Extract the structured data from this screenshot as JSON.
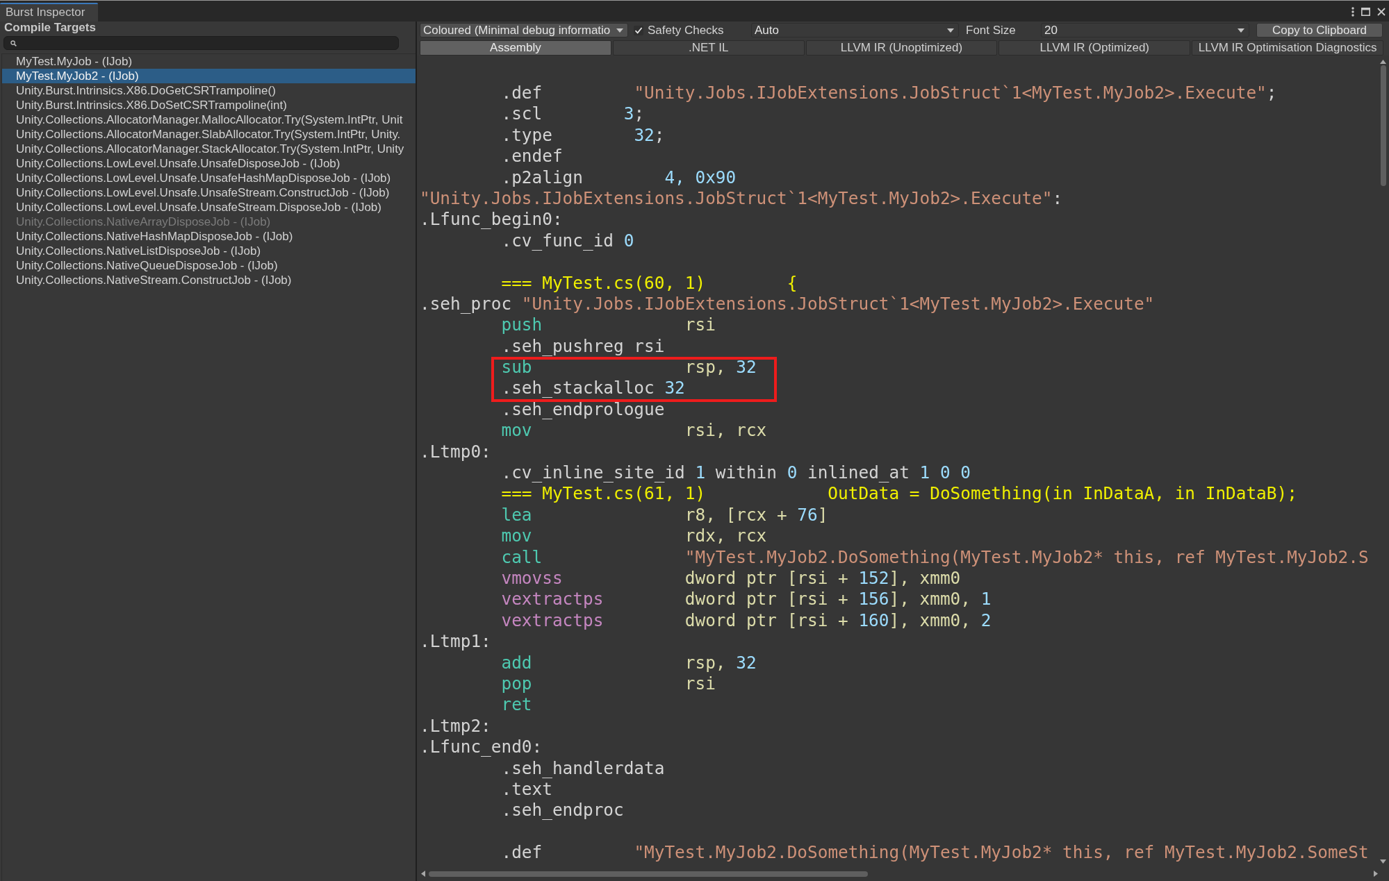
{
  "window": {
    "tab": "Burst Inspector"
  },
  "sidebar": {
    "title": "Compile Targets",
    "items": [
      {
        "label": "MyTest.MyJob - (IJob)",
        "selected": false,
        "disabled": false
      },
      {
        "label": "MyTest.MyJob2 - (IJob)",
        "selected": true,
        "disabled": false
      },
      {
        "label": "Unity.Burst.Intrinsics.X86.DoGetCSRTrampoline()",
        "selected": false,
        "disabled": false
      },
      {
        "label": "Unity.Burst.Intrinsics.X86.DoSetCSRTrampoline(int)",
        "selected": false,
        "disabled": false
      },
      {
        "label": "Unity.Collections.AllocatorManager.MallocAllocator.Try(System.IntPtr, Unit",
        "selected": false,
        "disabled": false
      },
      {
        "label": "Unity.Collections.AllocatorManager.SlabAllocator.Try(System.IntPtr, Unity.",
        "selected": false,
        "disabled": false
      },
      {
        "label": "Unity.Collections.AllocatorManager.StackAllocator.Try(System.IntPtr, Unity",
        "selected": false,
        "disabled": false
      },
      {
        "label": "Unity.Collections.LowLevel.Unsafe.UnsafeDisposeJob - (IJob)",
        "selected": false,
        "disabled": false
      },
      {
        "label": "Unity.Collections.LowLevel.Unsafe.UnsafeHashMapDisposeJob - (IJob)",
        "selected": false,
        "disabled": false
      },
      {
        "label": "Unity.Collections.LowLevel.Unsafe.UnsafeStream.ConstructJob - (IJob)",
        "selected": false,
        "disabled": false
      },
      {
        "label": "Unity.Collections.LowLevel.Unsafe.UnsafeStream.DisposeJob - (IJob)",
        "selected": false,
        "disabled": false
      },
      {
        "label": "Unity.Collections.NativeArrayDisposeJob - (IJob)",
        "selected": false,
        "disabled": true
      },
      {
        "label": "Unity.Collections.NativeHashMapDisposeJob - (IJob)",
        "selected": false,
        "disabled": false
      },
      {
        "label": "Unity.Collections.NativeListDisposeJob - (IJob)",
        "selected": false,
        "disabled": false
      },
      {
        "label": "Unity.Collections.NativeQueueDisposeJob - (IJob)",
        "selected": false,
        "disabled": false
      },
      {
        "label": "Unity.Collections.NativeStream.ConstructJob - (IJob)",
        "selected": false,
        "disabled": false
      }
    ]
  },
  "toolbar": {
    "output_mode": {
      "value": "Coloured (Minimal debug informatio"
    },
    "safety_checks": {
      "label": "Safety Checks",
      "checked": true
    },
    "target": {
      "value": "Auto"
    },
    "font_size": {
      "label": "Font Size",
      "value": "20"
    },
    "copy_button": "Copy to Clipboard"
  },
  "tabs": [
    {
      "label": "Assembly",
      "selected": true
    },
    {
      "label": ".NET IL",
      "selected": false
    },
    {
      "label": "LLVM IR (Unoptimized)",
      "selected": false
    },
    {
      "label": "LLVM IR (Optimized)",
      "selected": false
    },
    {
      "label": "LLVM IR Optimisation Diagnostics",
      "selected": false
    }
  ],
  "code": {
    "sections": [
      {
        "gap_before": false,
        "boxed": false,
        "lines": [
          {
            "indented": true,
            "parts": [
              {
                "text": ".def         ",
                "kind": "plain"
              },
              {
                "text": "\"Unity.Jobs.IJobExtensions.JobStruct`1<MyTest.MyJob2>.Execute\"",
                "kind": "str"
              },
              {
                "text": ";",
                "kind": "plain"
              }
            ]
          },
          {
            "indented": true,
            "parts": [
              {
                "text": ".scl        ",
                "kind": "plain"
              },
              {
                "text": "3",
                "kind": "num"
              },
              {
                "text": ";",
                "kind": "plain"
              }
            ]
          },
          {
            "indented": true,
            "parts": [
              {
                "text": ".type        ",
                "kind": "plain"
              },
              {
                "text": "32",
                "kind": "num"
              },
              {
                "text": ";",
                "kind": "plain"
              }
            ]
          },
          {
            "indented": true,
            "parts": [
              {
                "text": ".endef",
                "kind": "plain"
              }
            ]
          },
          {
            "indented": true,
            "parts": [
              {
                "text": ".p2align        ",
                "kind": "plain"
              },
              {
                "text": "4, 0x90",
                "kind": "num"
              }
            ]
          },
          {
            "indented": false,
            "parts": [
              {
                "text": "\"Unity.Jobs.IJobExtensions.JobStruct`1<MyTest.MyJob2>.Execute\"",
                "kind": "str"
              },
              {
                "text": ":",
                "kind": "plain"
              }
            ]
          },
          {
            "indented": false,
            "parts": [
              {
                "text": ".Lfunc_begin0:",
                "kind": "plain"
              }
            ]
          },
          {
            "indented": true,
            "parts": [
              {
                "text": ".cv_func_id ",
                "kind": "plain"
              },
              {
                "text": "0",
                "kind": "num"
              }
            ]
          }
        ]
      },
      {
        "gap_before": true,
        "boxed": false,
        "lines": [
          {
            "indented": true,
            "parts": [
              {
                "text": "=== MyTest.cs(60, 1)        {",
                "kind": "src"
              }
            ]
          },
          {
            "indented": false,
            "parts": [
              {
                "text": ".seh_proc ",
                "kind": "plain"
              },
              {
                "text": "\"Unity.Jobs.IJobExtensions.JobStruct`1<MyTest.MyJob2>.Execute\"",
                "kind": "str"
              }
            ]
          },
          {
            "indented": true,
            "parts": [
              {
                "text": "push",
                "kind": "op"
              },
              {
                "text": "rsi",
                "kind": "reg"
              }
            ]
          },
          {
            "indented": true,
            "parts": [
              {
                "text": ".seh_pushreg rsi",
                "kind": "plain"
              }
            ]
          }
        ]
      },
      {
        "gap_before": false,
        "boxed": true,
        "lines": [
          {
            "indented": true,
            "parts": [
              {
                "text": "sub",
                "kind": "op"
              },
              {
                "text": "rsp, ",
                "kind": "reg"
              },
              {
                "text": "32",
                "kind": "num"
              }
            ]
          },
          {
            "indented": true,
            "parts": [
              {
                "text": ".seh_stackalloc ",
                "kind": "plain"
              },
              {
                "text": "32",
                "kind": "num"
              }
            ]
          }
        ]
      },
      {
        "gap_before": false,
        "boxed": false,
        "lines": [
          {
            "indented": true,
            "parts": [
              {
                "text": ".seh_endprologue",
                "kind": "plain"
              }
            ]
          },
          {
            "indented": true,
            "parts": [
              {
                "text": "mov",
                "kind": "op"
              },
              {
                "text": "rsi, rcx",
                "kind": "reg"
              }
            ]
          },
          {
            "indented": false,
            "parts": [
              {
                "text": ".Ltmp0:",
                "kind": "plain"
              }
            ]
          },
          {
            "indented": true,
            "parts": [
              {
                "text": ".cv_inline_site_id ",
                "kind": "plain"
              },
              {
                "text": "1",
                "kind": "num"
              },
              {
                "text": " within ",
                "kind": "plain"
              },
              {
                "text": "0",
                "kind": "num"
              },
              {
                "text": " inlined_at ",
                "kind": "plain"
              },
              {
                "text": "1 0 0",
                "kind": "num"
              }
            ]
          },
          {
            "indented": true,
            "parts": [
              {
                "text": "=== MyTest.cs(61, 1)            OutData = DoSomething(in InDataA, in InDataB);",
                "kind": "src"
              }
            ]
          },
          {
            "indented": true,
            "parts": [
              {
                "text": "lea",
                "kind": "op"
              },
              {
                "text": "r8, [rcx + ",
                "kind": "reg"
              },
              {
                "text": "76",
                "kind": "num"
              },
              {
                "text": "]",
                "kind": "reg"
              }
            ]
          },
          {
            "indented": true,
            "parts": [
              {
                "text": "mov",
                "kind": "op"
              },
              {
                "text": "rdx, rcx",
                "kind": "reg"
              }
            ]
          },
          {
            "indented": true,
            "parts": [
              {
                "text": "call",
                "kind": "op"
              },
              {
                "text": "\"MyTest.MyJob2.DoSomething(MyTest.MyJob2* this, ref MyTest.MyJob2.S",
                "kind": "str"
              }
            ]
          },
          {
            "indented": true,
            "parts": [
              {
                "text": "vmovss",
                "kind": "vop"
              },
              {
                "text": "dword ptr [rsi + ",
                "kind": "reg"
              },
              {
                "text": "152",
                "kind": "num"
              },
              {
                "text": "], xmm0",
                "kind": "reg"
              }
            ]
          },
          {
            "indented": true,
            "parts": [
              {
                "text": "vextractps",
                "kind": "vop"
              },
              {
                "text": "dword ptr [rsi + ",
                "kind": "reg"
              },
              {
                "text": "156",
                "kind": "num"
              },
              {
                "text": "], xmm0, ",
                "kind": "reg"
              },
              {
                "text": "1",
                "kind": "num"
              }
            ]
          },
          {
            "indented": true,
            "parts": [
              {
                "text": "vextractps",
                "kind": "vop"
              },
              {
                "text": "dword ptr [rsi + ",
                "kind": "reg"
              },
              {
                "text": "160",
                "kind": "num"
              },
              {
                "text": "], xmm0, ",
                "kind": "reg"
              },
              {
                "text": "2",
                "kind": "num"
              }
            ]
          },
          {
            "indented": false,
            "parts": [
              {
                "text": ".Ltmp1:",
                "kind": "plain"
              }
            ]
          },
          {
            "indented": true,
            "parts": [
              {
                "text": "add",
                "kind": "op"
              },
              {
                "text": "rsp, ",
                "kind": "reg"
              },
              {
                "text": "32",
                "kind": "num"
              }
            ]
          },
          {
            "indented": true,
            "parts": [
              {
                "text": "pop",
                "kind": "op"
              },
              {
                "text": "rsi",
                "kind": "reg"
              }
            ]
          },
          {
            "indented": true,
            "parts": [
              {
                "text": "ret",
                "kind": "op"
              }
            ]
          },
          {
            "indented": false,
            "parts": [
              {
                "text": ".Ltmp2:",
                "kind": "plain"
              }
            ]
          },
          {
            "indented": false,
            "parts": [
              {
                "text": ".Lfunc_end0:",
                "kind": "plain"
              }
            ]
          },
          {
            "indented": true,
            "parts": [
              {
                "text": ".seh_handlerdata",
                "kind": "plain"
              }
            ]
          },
          {
            "indented": true,
            "parts": [
              {
                "text": ".text",
                "kind": "plain"
              }
            ]
          },
          {
            "indented": true,
            "parts": [
              {
                "text": ".seh_endproc",
                "kind": "plain"
              }
            ]
          }
        ]
      },
      {
        "gap_before": true,
        "boxed": false,
        "lines": [
          {
            "indented": true,
            "parts": [
              {
                "text": ".def         ",
                "kind": "plain"
              },
              {
                "text": "\"MyTest.MyJob2.DoSomething(MyTest.MyJob2* this, ref MyTest.MyJob2.SomeSt",
                "kind": "str"
              }
            ]
          }
        ]
      }
    ]
  }
}
